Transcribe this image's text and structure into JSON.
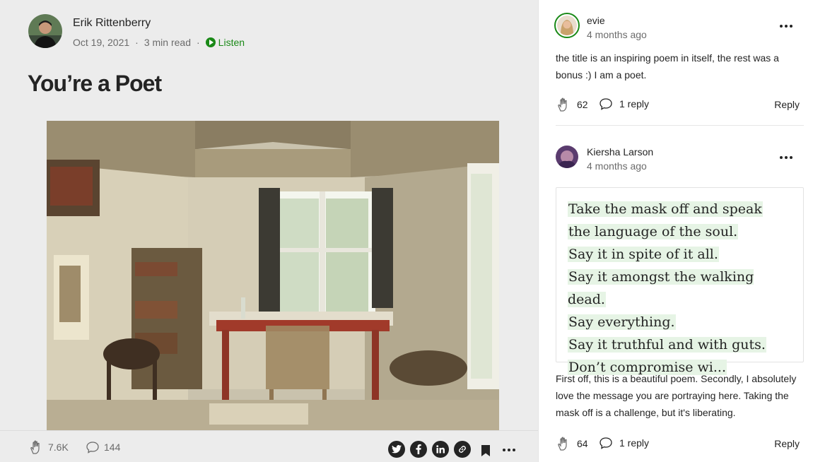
{
  "article": {
    "author": "Erik Rittenberry",
    "date": "Oct 19, 2021",
    "read_time": "3 min read",
    "dot": "·",
    "listen_label": "Listen",
    "title": "You’re a Poet",
    "claps": "7.6K",
    "responses": "144"
  },
  "comments": [
    {
      "author": "evie",
      "time": "4 months ago",
      "text": "the title is an inspiring poem in itself, the rest was a bonus :) I am a poet.",
      "claps": "62",
      "replies": "1 reply",
      "reply_label": "Reply"
    },
    {
      "author": "Kiersha Larson",
      "time": "4 months ago",
      "quote": [
        "Take the mask off and speak",
        "the language of the soul.",
        "Say it in spite of it all.",
        "Say it amongst the walking dead.",
        "Say everything.",
        "Say it truthful and with guts.",
        "Don’t compromise wi..."
      ],
      "text": "First off, this is a beautiful poem. Secondly, I absolutely love the message you are portraying here. Taking the mask off is a challenge, but it's liberating.",
      "claps": "64",
      "replies": "1 reply",
      "reply_label": "Reply"
    }
  ],
  "share_icons": [
    "twitter-icon",
    "facebook-icon",
    "linkedin-icon",
    "link-icon"
  ],
  "colors": {
    "accent_green": "#1a8917",
    "highlight": "#e6f4e5",
    "text": "#242424",
    "muted": "#6b6b6b"
  }
}
